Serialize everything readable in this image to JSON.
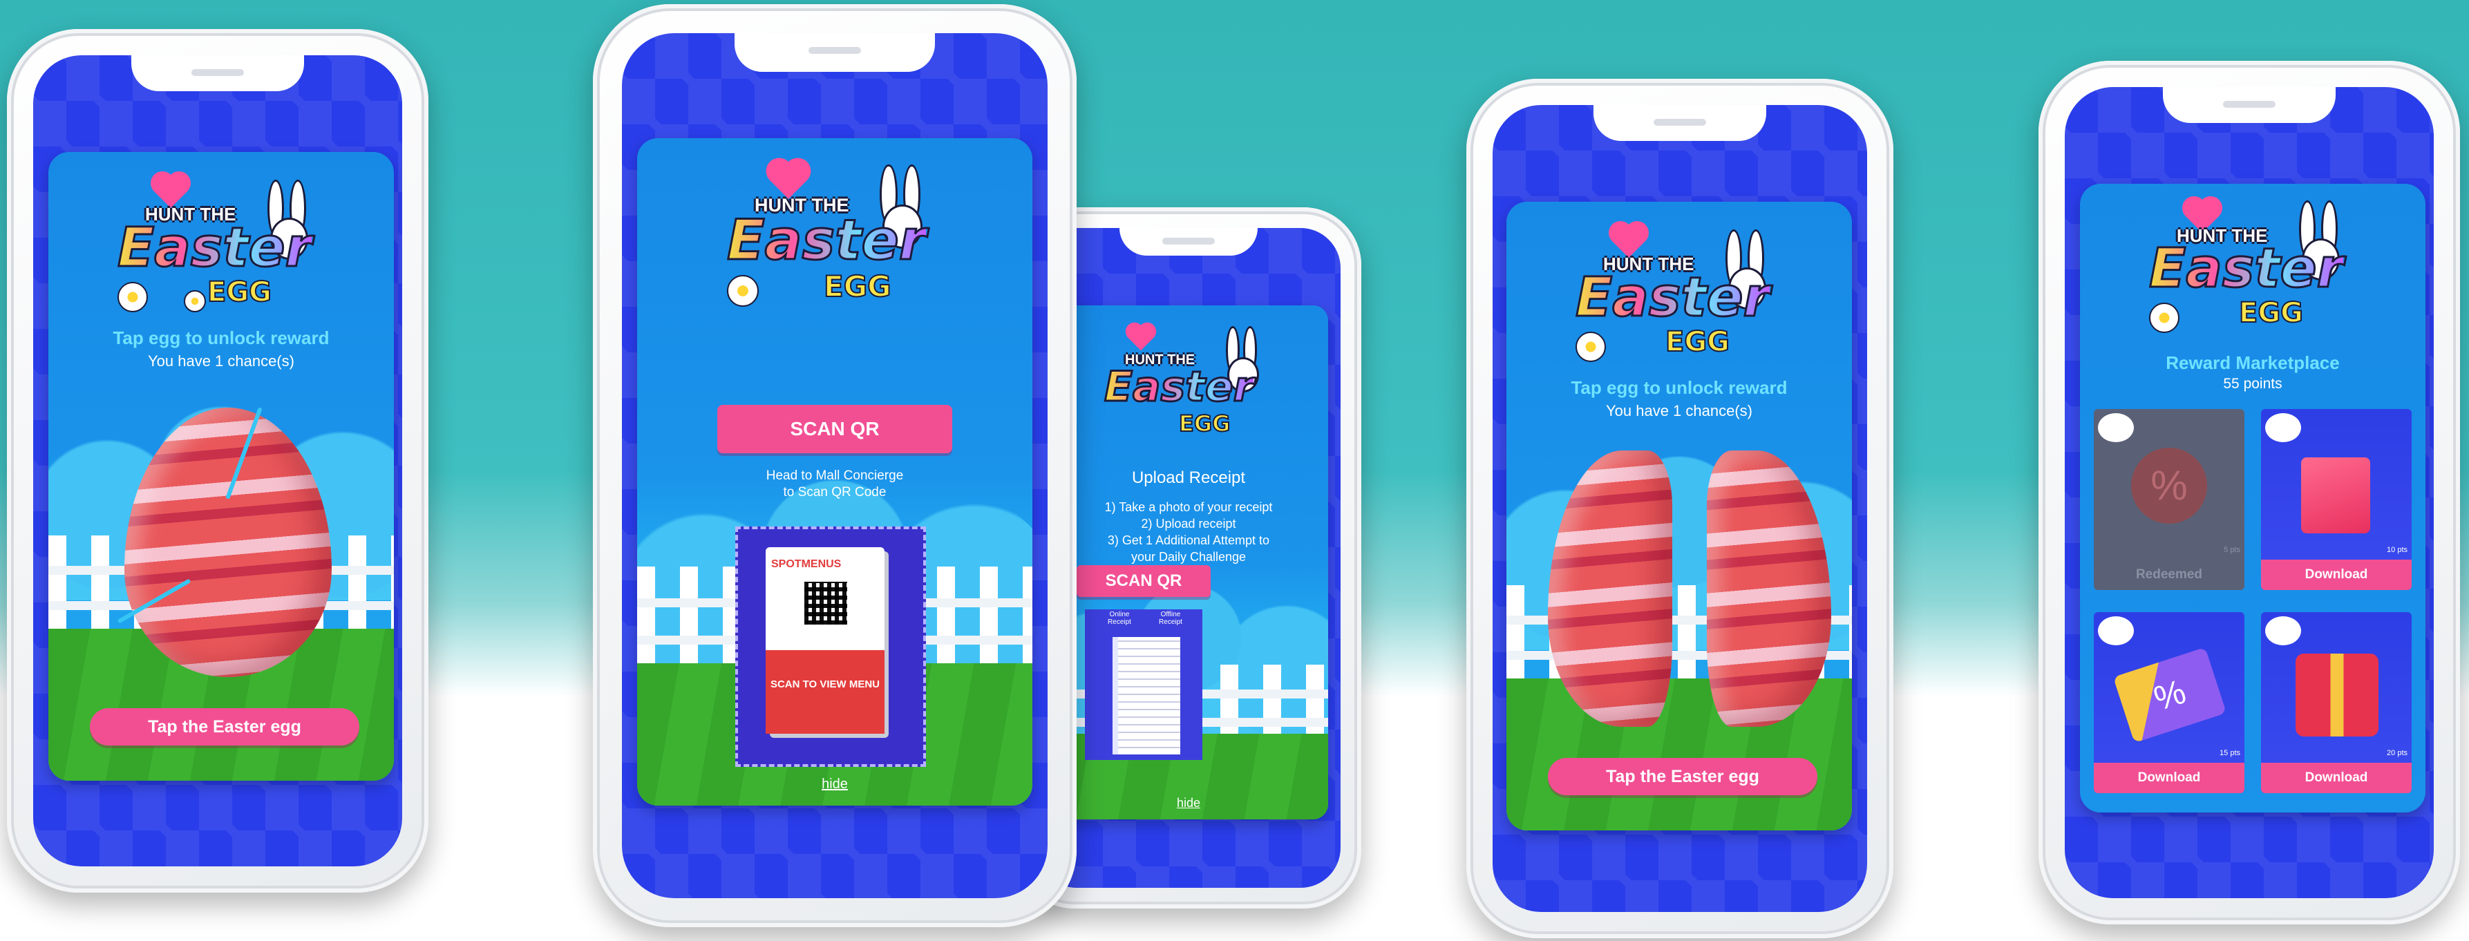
{
  "screens": {
    "tap_egg_1": {
      "prompt": "Tap egg to unlock reward",
      "chances": "You have 1 chance(s)",
      "button": "Tap the Easter egg"
    },
    "scan_qr": {
      "button": "SCAN QR",
      "instruction_line1": "Head to Mall Concierge",
      "instruction_line2": "to Scan QR Code",
      "tent_brand": "SPOTMENUS",
      "tent_text": "SCAN TO VIEW MENU",
      "hide_link": "hide"
    },
    "upload_receipt": {
      "title": "Upload Receipt",
      "step1": "1) Take a photo of your receipt",
      "step2": "2) Upload receipt",
      "step3": "3) Get 1 Additional Attempt to",
      "step3b": "your Daily Challenge",
      "button": "SCAN QR",
      "col_online": "Online Receipt",
      "col_offline": "Offline Receipt",
      "hide_link": "hide"
    },
    "tap_egg_2": {
      "prompt": "Tap egg to unlock reward",
      "chances": "You have 1 chance(s)",
      "button": "Tap the Easter egg"
    },
    "marketplace": {
      "title": "Reward Marketplace",
      "points": "55 points",
      "tiles": [
        {
          "label": "Redeemed",
          "pts": "5 pts",
          "icon": "discount-badge-icon"
        },
        {
          "label": "Download",
          "pts": "10 pts",
          "icon": "shopping-bag-icon"
        },
        {
          "label": "Download",
          "pts": "15 pts",
          "icon": "coupon-icon"
        },
        {
          "label": "Download",
          "pts": "20 pts",
          "icon": "gift-box-icon"
        }
      ]
    }
  },
  "logo": {
    "line1": "HUNT THE",
    "line2": "Easter",
    "line3": "EGG"
  },
  "colors": {
    "accent": "#f24f93",
    "screen_bg": "#2a3dea",
    "card_bg": "#178ae6",
    "title_cyan": "#6fe3ff"
  }
}
